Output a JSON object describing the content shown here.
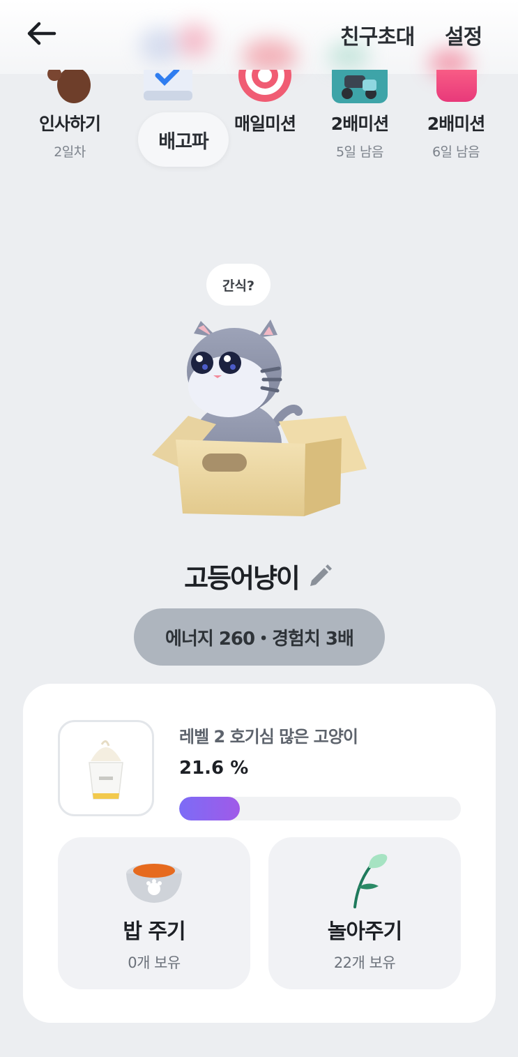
{
  "header": {
    "invite_label": "친구초대",
    "settings_label": "설정"
  },
  "missions": [
    {
      "label": "인사하기",
      "sub": "2일차",
      "icon": "paw-icon"
    },
    {
      "label": "",
      "sub": "",
      "icon": "checklist-icon"
    },
    {
      "label": "매일미션",
      "sub": "",
      "icon": "target-icon"
    },
    {
      "label": "2배미션",
      "sub": "5일 남음",
      "icon": "scooter-icon"
    },
    {
      "label": "2배미션",
      "sub": "6일 남음",
      "icon": "gift-icon"
    }
  ],
  "pet": {
    "status_bubble": "배고파",
    "speech_bubble": "간식?",
    "name": "고등어냥이",
    "stats": "에너지 260・경험치 3배"
  },
  "level": {
    "title": "레벨 2 호기심 많은 고양이",
    "percent_label": "21.6 %",
    "progress": 0.216
  },
  "actions": {
    "feed": {
      "label": "밥 주기",
      "count": "0개 보유"
    },
    "play": {
      "label": "놀아주기",
      "count": "22개 보유"
    }
  },
  "colors": {
    "progress_start": "#7c6cf6",
    "progress_end": "#a05ae8",
    "pill_bg": "#aeb5be"
  }
}
